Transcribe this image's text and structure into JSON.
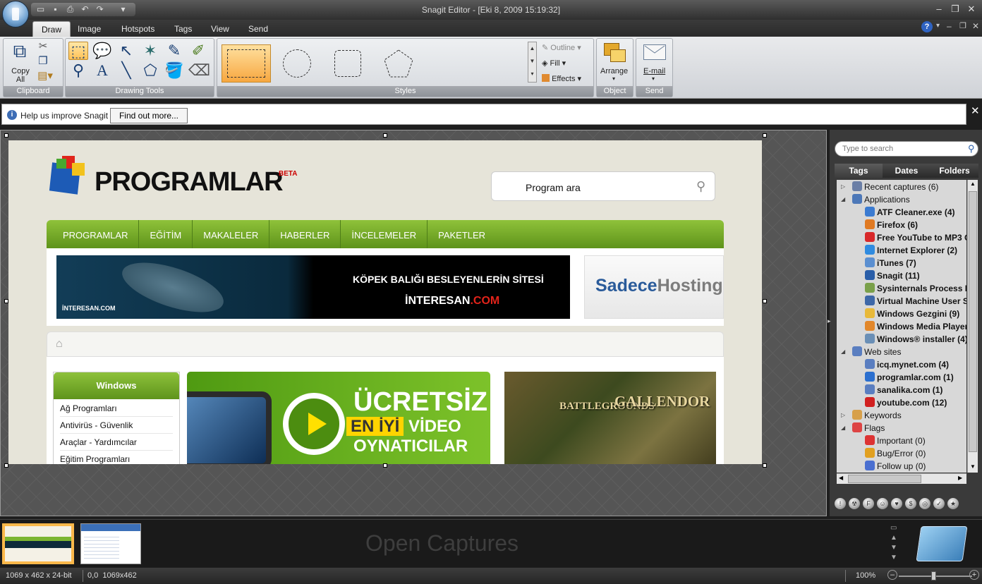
{
  "app": {
    "title": "Snagit Editor",
    "document": "[Eki 8, 2009 15:19:32]"
  },
  "quick_access": [
    "folder-icon",
    "save-icon",
    "print-icon",
    "undo-icon",
    "redo-icon",
    "customize-icon"
  ],
  "ribbon": {
    "tabs": [
      "Draw",
      "Image",
      "Hotspots",
      "Tags",
      "View",
      "Send"
    ],
    "active_tab": "Draw",
    "groups": {
      "clipboard": {
        "label": "Clipboard",
        "copy_all": "Copy\nAll"
      },
      "drawing_tools": {
        "label": "Drawing Tools"
      },
      "styles": {
        "label": "Styles",
        "outline": "Outline",
        "fill": "Fill",
        "effects": "Effects"
      },
      "object": {
        "label": "Object",
        "arrange": "Arrange"
      },
      "send": {
        "label": "Send",
        "email": "E-mail"
      }
    }
  },
  "infobar": {
    "message": "Help us improve Snagit",
    "button": "Find out more..."
  },
  "website": {
    "logo": "PROGRAMLAR",
    "beta": "BETA",
    "search_placeholder": "Program ara",
    "nav": [
      "PROGRAMLAR",
      "EĞİTİM",
      "MAKALELER",
      "HABERLER",
      "İNCELEMELER",
      "PAKETLER"
    ],
    "banner": {
      "line1": "KÖPEK BALIĞI BESLEYENLERİN SİTESİ",
      "line2a": "İNTERESAN",
      "line2b": ".COM",
      "corner": "İNTERESAN.COM"
    },
    "sponsor": {
      "a": "Sadece",
      "b": "Hosting"
    },
    "sidebar": {
      "title": "Windows",
      "items": [
        "Ağ Programları",
        "Antivirüs - Güvenlik",
        "Araçlar - Yardımcılar",
        "Eğitim Programları"
      ]
    },
    "ad1": {
      "l1": "ÜCRETSİZ",
      "l2a": "EN İYİ",
      "l2b": "VİDEO",
      "l3": "OYNATICILAR"
    },
    "ad2": {
      "title": "GALLENDOR",
      "sub": "BATTLEGROUNDS"
    }
  },
  "library": {
    "search_placeholder": "Type to search",
    "tabs": [
      "Tags",
      "Dates",
      "Folders"
    ],
    "active_tab": "Tags",
    "tree": [
      {
        "label": "Recent captures (6)",
        "level": 0,
        "expander": "▷",
        "color": "#6b7fa6"
      },
      {
        "label": "Applications",
        "level": 0,
        "expander": "◢",
        "color": "#4d78b8"
      },
      {
        "label": "ATF Cleaner.exe (4)",
        "level": 1,
        "color": "#3b7bd1",
        "bold": true
      },
      {
        "label": "Firefox (6)",
        "level": 1,
        "color": "#e07a22",
        "bold": true
      },
      {
        "label": "Free YouTube to MP3 C",
        "level": 1,
        "color": "#d8282a",
        "bold": true
      },
      {
        "label": "Internet Explorer (2)",
        "level": 1,
        "color": "#2f8be0",
        "bold": true
      },
      {
        "label": "iTunes (7)",
        "level": 1,
        "color": "#5b8fd0",
        "bold": true
      },
      {
        "label": "Snagit (11)",
        "level": 1,
        "color": "#2a5ea8",
        "bold": true
      },
      {
        "label": "Sysinternals Process E",
        "level": 1,
        "color": "#7aa04a",
        "bold": true
      },
      {
        "label": "Virtual Machine User S",
        "level": 1,
        "color": "#3e68a8",
        "bold": true
      },
      {
        "label": "Windows Gezgini (9)",
        "level": 1,
        "color": "#e8b93a",
        "bold": true
      },
      {
        "label": "Windows Media Player",
        "level": 1,
        "color": "#e2872a",
        "bold": true
      },
      {
        "label": "Windows® installer (4)",
        "level": 1,
        "color": "#6a8fb6",
        "bold": true
      },
      {
        "label": "Web sites",
        "level": 0,
        "expander": "◢",
        "color": "#5a7ec0"
      },
      {
        "label": "icq.mynet.com (4)",
        "level": 1,
        "color": "#5a7ec0",
        "bold": true
      },
      {
        "label": "programlar.com (1)",
        "level": 1,
        "color": "#2b6fcf",
        "bold": true
      },
      {
        "label": "sanalika.com (1)",
        "level": 1,
        "color": "#5a7ec0",
        "bold": true
      },
      {
        "label": "youtube.com (12)",
        "level": 1,
        "color": "#d12020",
        "bold": true
      },
      {
        "label": "Keywords",
        "level": 0,
        "expander": "▷",
        "color": "#d7a04a"
      },
      {
        "label": "Flags",
        "level": 0,
        "expander": "◢",
        "color": "#d44"
      },
      {
        "label": "Important (0)",
        "level": 1,
        "color": "#d33"
      },
      {
        "label": "Bug/Error (0)",
        "level": 1,
        "color": "#e1a020"
      },
      {
        "label": "Follow up (0)",
        "level": 1,
        "color": "#4a6fd0"
      }
    ]
  },
  "tray": {
    "label": "Open Captures"
  },
  "status": {
    "dimensions": "1069 x 462 x 24-bit",
    "coords": "0,0  1069x462",
    "zoom": "100%"
  }
}
